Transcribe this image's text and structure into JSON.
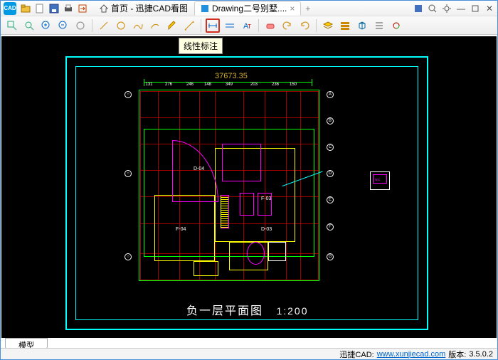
{
  "titlebar": {
    "tabs": [
      {
        "label": "首页 - 迅捷CAD看图",
        "active": false
      },
      {
        "label": "Drawing二号别墅....",
        "active": true
      }
    ]
  },
  "toolbar": {
    "tooltip": "线性标注"
  },
  "drawing": {
    "dimension": "37673.35",
    "title": "负一层平面图",
    "scale": "1:200",
    "grid_cols": [
      "131",
      "276",
      "246",
      "148",
      "349",
      "203",
      "236",
      "150"
    ],
    "rooms": {
      "r1": "F-04",
      "r2": "D-04",
      "r3": "D-03",
      "r4": "F-03"
    },
    "side_labels": [
      "A",
      "B",
      "C",
      "D",
      "E",
      "F",
      "G"
    ],
    "inset_label": "w.c"
  },
  "bottom": {
    "tab": "模型"
  },
  "status": {
    "app": "迅捷CAD:",
    "url": "www.xunjiecad.com",
    "ver_label": "版本:",
    "version": "3.5.0.2"
  }
}
